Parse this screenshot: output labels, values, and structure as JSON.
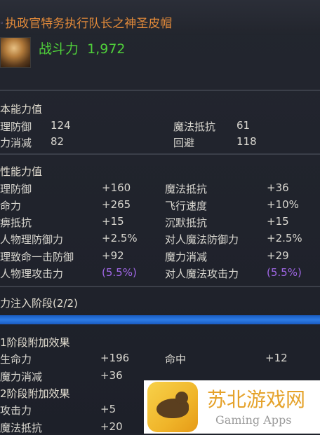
{
  "item": {
    "name": "执政官特务执行队长之神圣皮帽",
    "bullet": "◦",
    "power_label": "战斗力",
    "power_value": "1,972"
  },
  "basic": {
    "title": "本能力值",
    "rows": [
      {
        "l_label": "理防御",
        "l_value": "124",
        "r_label": "魔法抵抗",
        "r_value": "61"
      },
      {
        "l_label": "力消减",
        "l_value": "82",
        "r_label": "回避",
        "r_value": "118"
      }
    ]
  },
  "bonus": {
    "title": "性能力值",
    "rows": [
      {
        "l_label": "理防御",
        "l_value": "+160",
        "r_label": "魔法抵抗",
        "r_value": "+36"
      },
      {
        "l_label": "命力",
        "l_value": "+265",
        "r_label": "飞行速度",
        "r_value": "+10%"
      },
      {
        "l_label": "痹抵抗",
        "l_value": "+15",
        "r_label": "沉默抵抗",
        "r_value": "+15"
      },
      {
        "l_label": "人物理防御力",
        "l_value": "+2.5%",
        "r_label": "对人魔法防御力",
        "r_value": "+2.5%"
      },
      {
        "l_label": "理致命一击防御",
        "l_value": "+92",
        "r_label": "魔力消减",
        "r_value": "+29"
      },
      {
        "l_label": "人物理攻击力",
        "l_value": "(5.5%)",
        "r_label": "对人魔法攻击力",
        "r_value": "(5.5%)"
      }
    ]
  },
  "enchant": {
    "title": "力注入阶段(2/2)",
    "stage1_title": "1阶段附加效果",
    "stage1_rows": [
      {
        "l_label": "生命力",
        "l_value": "+196",
        "r_label": "命中",
        "r_value": "+12"
      },
      {
        "l_label": "魔力消减",
        "l_value": "+36"
      }
    ],
    "stage2_title": "2阶段附加效果",
    "stage2_rows": [
      {
        "l_label": "攻击力",
        "l_value": "+5"
      },
      {
        "l_label": "魔法抵抗",
        "l_value": "+20"
      }
    ]
  },
  "watermark": {
    "cn": "苏北游戏网",
    "en": "Gaming Apps"
  }
}
